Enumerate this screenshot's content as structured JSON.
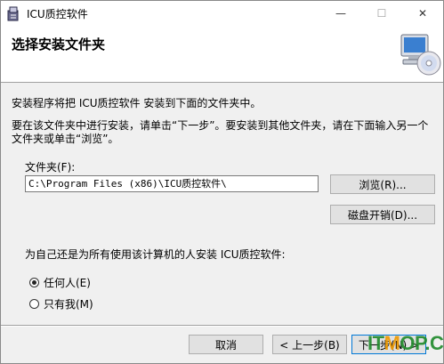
{
  "window": {
    "title": "ICU质控软件",
    "controls": {
      "minimize": "—",
      "maximize": "☐",
      "close": "✕"
    }
  },
  "header": {
    "title": "选择安装文件夹"
  },
  "body": {
    "intro": "安装程序将把 ICU质控软件 安装到下面的文件夹中。",
    "instructions": "要在该文件夹中进行安装，请单击“下一步”。要安装到其他文件夹，请在下面输入另一个文件夹或单击“浏览”。",
    "folder_label": "文件夹(F):",
    "folder_value": "C:\\Program Files (x86)\\ICU质控软件\\",
    "browse_button": "浏览(R)...",
    "disk_cost_button": "磁盘开销(D)...",
    "install_for_question": "为自己还是为所有使用该计算机的人安装 ICU质控软件:",
    "radio_everyone": "任何人(E)",
    "radio_just_me": "只有我(M)",
    "selected_option": "everyone"
  },
  "footer": {
    "cancel_button": "取消",
    "back_button": "< 上一步(B)",
    "next_button": "下一步(N) >"
  },
  "watermark": {
    "prefix": "IT",
    "o": "M",
    "suffix": "OP.COM"
  }
}
